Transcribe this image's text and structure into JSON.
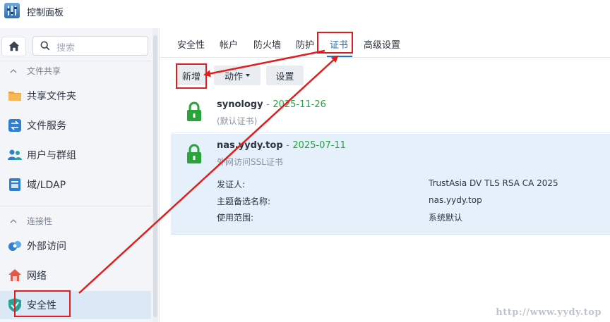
{
  "window": {
    "title": "控制面板",
    "icon": "control-panel-icon"
  },
  "sidebar": {
    "search_placeholder": "搜索",
    "sections": [
      {
        "label": "文件共享",
        "items": [
          {
            "label": "共享文件夹",
            "icon": "shared-folder-icon"
          },
          {
            "label": "文件服务",
            "icon": "file-services-icon"
          },
          {
            "label": "用户与群组",
            "icon": "user-group-icon"
          },
          {
            "label": "域/LDAP",
            "icon": "domain-ldap-icon"
          }
        ]
      },
      {
        "label": "连接性",
        "items": [
          {
            "label": "外部访问",
            "icon": "external-access-icon"
          },
          {
            "label": "网络",
            "icon": "network-icon"
          },
          {
            "label": "安全性",
            "icon": "security-shield-icon",
            "active": true
          }
        ]
      }
    ]
  },
  "tabs": [
    {
      "label": "安全性"
    },
    {
      "label": "帐户"
    },
    {
      "label": "防火墙"
    },
    {
      "label": "防护"
    },
    {
      "label": "证书",
      "active": true
    },
    {
      "label": "高级设置"
    }
  ],
  "toolbar": {
    "create_label": "新增",
    "action_label": "动作",
    "settings_label": "设置"
  },
  "certificates": [
    {
      "name": "synology",
      "separator": "-",
      "date": "2025-11-26",
      "description": "(默认证书)"
    },
    {
      "name": "nas.yydy.top",
      "separator": "-",
      "date": "2025-07-11",
      "description": "外网访问SSL证书",
      "details": [
        {
          "label": "发证人:",
          "value": "TrustAsia DV TLS RSA CA 2025"
        },
        {
          "label": "主题备选名称:",
          "value": "nas.yydy.top"
        },
        {
          "label": "使用范围:",
          "value": "系统默认"
        }
      ]
    }
  ],
  "watermark": "http://www.yydy.top",
  "colors": {
    "accent": "#1a73c7",
    "date_green": "#27a344",
    "highlight_red": "#e11d1d",
    "selected_row": "#e6f0fb"
  }
}
